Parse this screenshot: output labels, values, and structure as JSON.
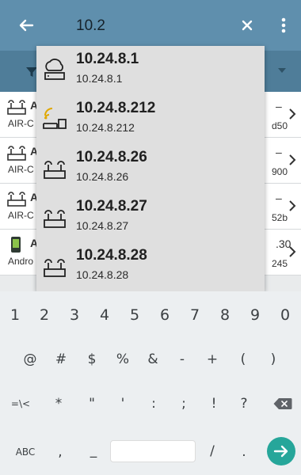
{
  "app_bar": {
    "search_value": "10.2",
    "back_icon": "arrow-left-icon",
    "clear_icon": "close-icon",
    "more_icon": "more-vert-icon",
    "color": "#5f8fad"
  },
  "filter_bar": {
    "filter_icon": "filter-icon",
    "color": "#4f7d99"
  },
  "background_list": [
    {
      "name": "A",
      "sub": "AIR-C",
      "dash": "–",
      "right": "d50",
      "icon": "access-point-icon"
    },
    {
      "name": "A",
      "sub": "AIR-C",
      "dash": "–",
      "right": "900",
      "icon": "access-point-icon"
    },
    {
      "name": "A",
      "sub": "AIR-C",
      "dash": "–",
      "right": "52b",
      "icon": "access-point-icon"
    },
    {
      "name": "A",
      "sub": "Andro",
      "dash": ".30",
      "right": "245",
      "icon": "phone-icon"
    }
  ],
  "suggestions": [
    {
      "title": "10.24.8.1",
      "sub": "10.24.8.1",
      "icon": "cloud-router-icon"
    },
    {
      "title": "10.24.8.212",
      "sub": "10.24.8.212",
      "icon": "wireless-device-icon"
    },
    {
      "title": "10.24.8.26",
      "sub": "10.24.8.26",
      "icon": "access-point-icon"
    },
    {
      "title": "10.24.8.27",
      "sub": "10.24.8.27",
      "icon": "access-point-icon"
    },
    {
      "title": "10.24.8.28",
      "sub": "10.24.8.28",
      "icon": "access-point-icon"
    }
  ],
  "keyboard": {
    "row1": [
      "1",
      "2",
      "3",
      "4",
      "5",
      "6",
      "7",
      "8",
      "9",
      "0"
    ],
    "row2": [
      "@",
      "#",
      "$",
      "%",
      "&",
      "-",
      "+",
      "(",
      ")"
    ],
    "row3": [
      "=\\<",
      "*",
      "\"",
      "'",
      ":",
      ";",
      "!",
      "?"
    ],
    "row4": {
      "abc": "ABC",
      "comma": ",",
      "underscore": "_",
      "slash": "/",
      "period": "."
    },
    "backspace_icon": "backspace-icon",
    "enter_icon": "arrow-right-icon",
    "accent": "#26a69a"
  }
}
